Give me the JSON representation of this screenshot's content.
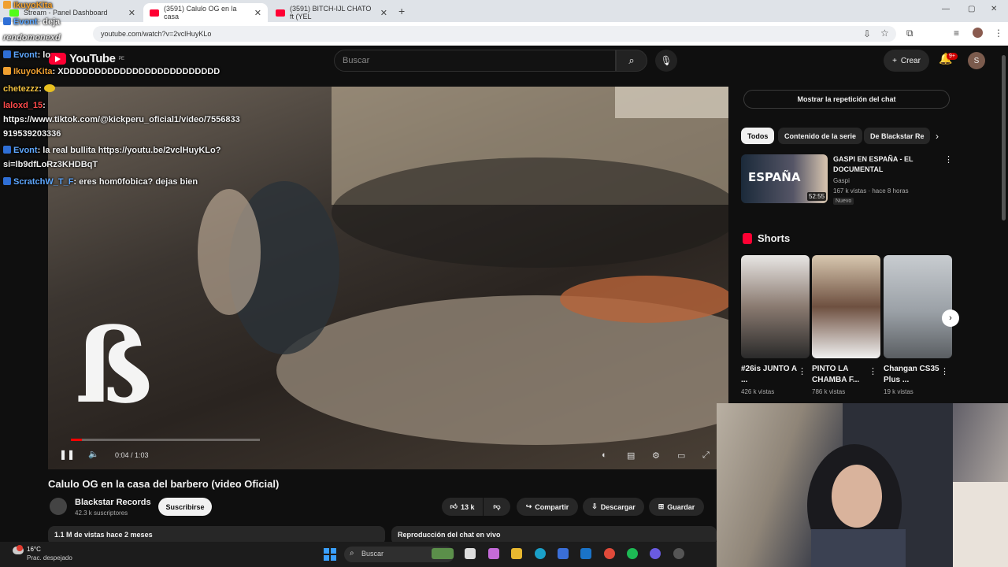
{
  "browser": {
    "tabs": [
      {
        "label": "Stream - Panel Dashboard"
      },
      {
        "label": "(3591) Calulo OG en la casa"
      },
      {
        "label": "(3591) BITCH-IJL CHATO ft (YEL"
      }
    ],
    "url": "youtube.com/watch?v=2vclHuyKLo",
    "new_tab": "+"
  },
  "youtube": {
    "logo": "YouTube",
    "logo_region": "PE",
    "search_placeholder": "Buscar",
    "create_label": "Crear",
    "notif_count": "9+",
    "avatar_letter": "S"
  },
  "video": {
    "title": "Calulo OG en la casa del barbero (video Oficial)",
    "time": "0:04 / 1:03",
    "progress": 0.06,
    "overlay_logo": "ß"
  },
  "channel": {
    "name": "Blackstar Records",
    "subscribers": "42.3 k suscriptores",
    "subscribe_label": "Suscribirse"
  },
  "actions": {
    "likes": "13 k",
    "share": "Compartir",
    "download": "Descargar",
    "save": "Guardar"
  },
  "description": {
    "views": "1.1 M de vistas  hace 2 meses"
  },
  "live_chat_replay": "Reproducción del chat en vivo",
  "sidebar": {
    "show_replay": "Mostrar la repetición del chat",
    "chips": [
      "Todos",
      "Contenido de la serie",
      "De Blackstar Re"
    ],
    "recommended": {
      "thumb_text": "ESPAÑA",
      "duration": "52:55",
      "title": "GASPI EN ESPAÑA - EL DOCUMENTAL",
      "channel": "Gaspi",
      "meta": "167 k vistas · hace 8 horas",
      "badge": "Nuevo"
    },
    "shorts_label": "Shorts",
    "shorts": [
      {
        "title": "#26is JUNTO A ...",
        "views": "426 k vistas"
      },
      {
        "title": "PINTO LA CHAMBA F...",
        "views": "786 k vistas"
      },
      {
        "title": "Changan CS35 Plus ...",
        "views": "19 k vistas"
      }
    ]
  },
  "chat": [
    {
      "user": "IkuyoKita",
      "text": "",
      "color": "#f0a030"
    },
    {
      "user": "Evont",
      "text": ": deja",
      "color": "#5fa8ff"
    },
    {
      "user": "rendomonexd",
      "text": "",
      "color": "#e0e0e0"
    },
    {
      "user": "Evont",
      "text": ": lo",
      "color": "#5fa8ff"
    },
    {
      "user": "IkuyoKita",
      "text": ": XDDDDDDDDDDDDDDDDDDDDDDDDD",
      "color": "#f0a030"
    },
    {
      "user": "chetezzz",
      "text": ":",
      "color": "#f0c040"
    },
    {
      "user": "laloxd_15",
      "text": ":",
      "color": "#ff4a4a"
    },
    {
      "user": "",
      "text": "https://www.tiktok.com/@kickperu_oficial1/video/7556833",
      "color": "#fff"
    },
    {
      "user": "",
      "text": "919539203336",
      "color": "#fff"
    },
    {
      "user": "Evont",
      "text": ": la real bullita https://youtu.be/2vclHuyKLo?",
      "color": "#5fa8ff"
    },
    {
      "user": "",
      "text": "si=lb9dfLoRz3KHDBqT",
      "color": "#fff"
    },
    {
      "user": "ScratchW_T_F",
      "text": ": eres hom0fobica? dejas bien",
      "color": "#5fa8ff"
    }
  ],
  "taskbar": {
    "temperature": "16°C",
    "weather": "Prac. despejado",
    "search": "Buscar"
  }
}
